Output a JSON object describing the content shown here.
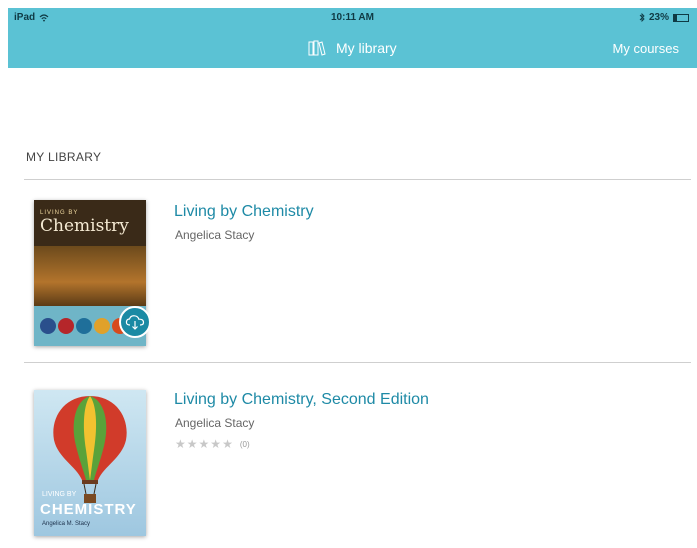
{
  "status_bar": {
    "device": "iPad",
    "time": "10:11 AM",
    "battery": "23%",
    "battery_fraction": 0.23
  },
  "nav": {
    "title": "My library",
    "title_icon": "books-icon",
    "right_link": "My courses"
  },
  "section": {
    "title": "MY LIBRARY"
  },
  "books": [
    {
      "title": "Living by Chemistry",
      "author": "Angelica Stacy",
      "cover_word": "Chemistry",
      "cover_brand": "LIVING BY",
      "download_icon": "cloud-download-icon"
    },
    {
      "title": "Living by Chemistry, Second Edition",
      "author": "Angelica Stacy",
      "rating_count": "(0)",
      "stars": 0,
      "cover_word": "CHEMISTRY",
      "cover_small": "LIVING BY",
      "cover_author": "Angelica M. Stacy"
    }
  ],
  "colors": {
    "accent": "#5bc2d4",
    "title_link": "#1e8aa6",
    "badge": "#1a8aa4"
  }
}
